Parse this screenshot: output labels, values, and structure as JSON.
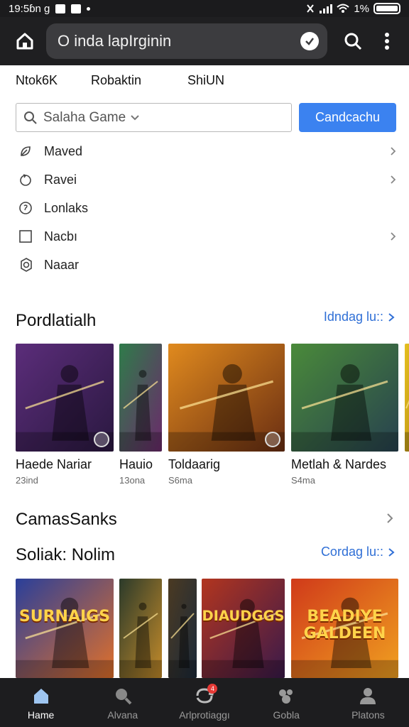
{
  "status_bar": {
    "time": "19:5ɓn g",
    "battery": "1%"
  },
  "app_bar": {
    "url_text": "O inda lapIrginin"
  },
  "tabs": [
    "Ntok6K",
    "Robaktin",
    "ShiUN"
  ],
  "search": {
    "placeholder": "Salaha Game",
    "button_label": "Candcachu"
  },
  "menu": [
    {
      "label": "Maved",
      "icon": "leaf-icon",
      "chevron": true
    },
    {
      "label": "Ravei",
      "icon": "refresh-icon",
      "chevron": true
    },
    {
      "label": "Lonlaks",
      "icon": "info-circle-icon",
      "chevron": false
    },
    {
      "label": "Nacbı",
      "icon": "square-icon",
      "chevron": true
    },
    {
      "label": "Naaar",
      "icon": "settings-icon",
      "chevron": false
    }
  ],
  "section1": {
    "title": "Pordlatialh",
    "link": "Idndag lu::",
    "games": [
      {
        "name": "Haede Nariar",
        "meta": "23ind",
        "colors": [
          "#5b2d7a",
          "#2a1840"
        ]
      },
      {
        "name": "Hauio",
        "meta": "13ona",
        "colors": [
          "#2f7b4a",
          "#6b2a6b"
        ]
      },
      {
        "name": "Toldaarig",
        "meta": "S6ma",
        "colors": [
          "#e08a1e",
          "#6a2e12"
        ]
      },
      {
        "name": "Metlah & Nardes",
        "meta": "S4ma",
        "colors": [
          "#4a8a3a",
          "#27414f"
        ]
      },
      {
        "name": "",
        "meta": "",
        "colors": [
          "#e6c020",
          "#b38a12"
        ]
      }
    ]
  },
  "section2": {
    "title": "CamasSanks"
  },
  "section3": {
    "title": "Soliak: Nolim",
    "link": "Cordag lu::",
    "games": [
      {
        "name": "SURNAIGS",
        "colors": [
          "#2a3f9a",
          "#e0702a"
        ]
      },
      {
        "name": "",
        "colors": [
          "#2b3a2a",
          "#c28a2a"
        ]
      },
      {
        "name": "",
        "colors": [
          "#4b3a22",
          "#1c2a3a"
        ]
      },
      {
        "name": "DIAUDGGS",
        "colors": [
          "#b2351f",
          "#3a1a4a"
        ]
      },
      {
        "name": "BEADIYE GALDEEN",
        "colors": [
          "#d03a1a",
          "#f0a020"
        ]
      }
    ]
  },
  "bottom_nav": [
    {
      "label": "Hame",
      "icon": "home-icon",
      "active": true
    },
    {
      "label": "Alvana",
      "icon": "search-icon",
      "active": false
    },
    {
      "label": "Arlprotiaggı",
      "icon": "sync-icon",
      "active": false,
      "badge": "4"
    },
    {
      "label": "Gobla",
      "icon": "controller-icon",
      "active": false
    },
    {
      "label": "Platons",
      "icon": "profile-icon",
      "active": false
    }
  ],
  "colors": {
    "accent": "#3b82f0",
    "link": "#2f6fd6",
    "dark_bar": "#1f1f21"
  }
}
